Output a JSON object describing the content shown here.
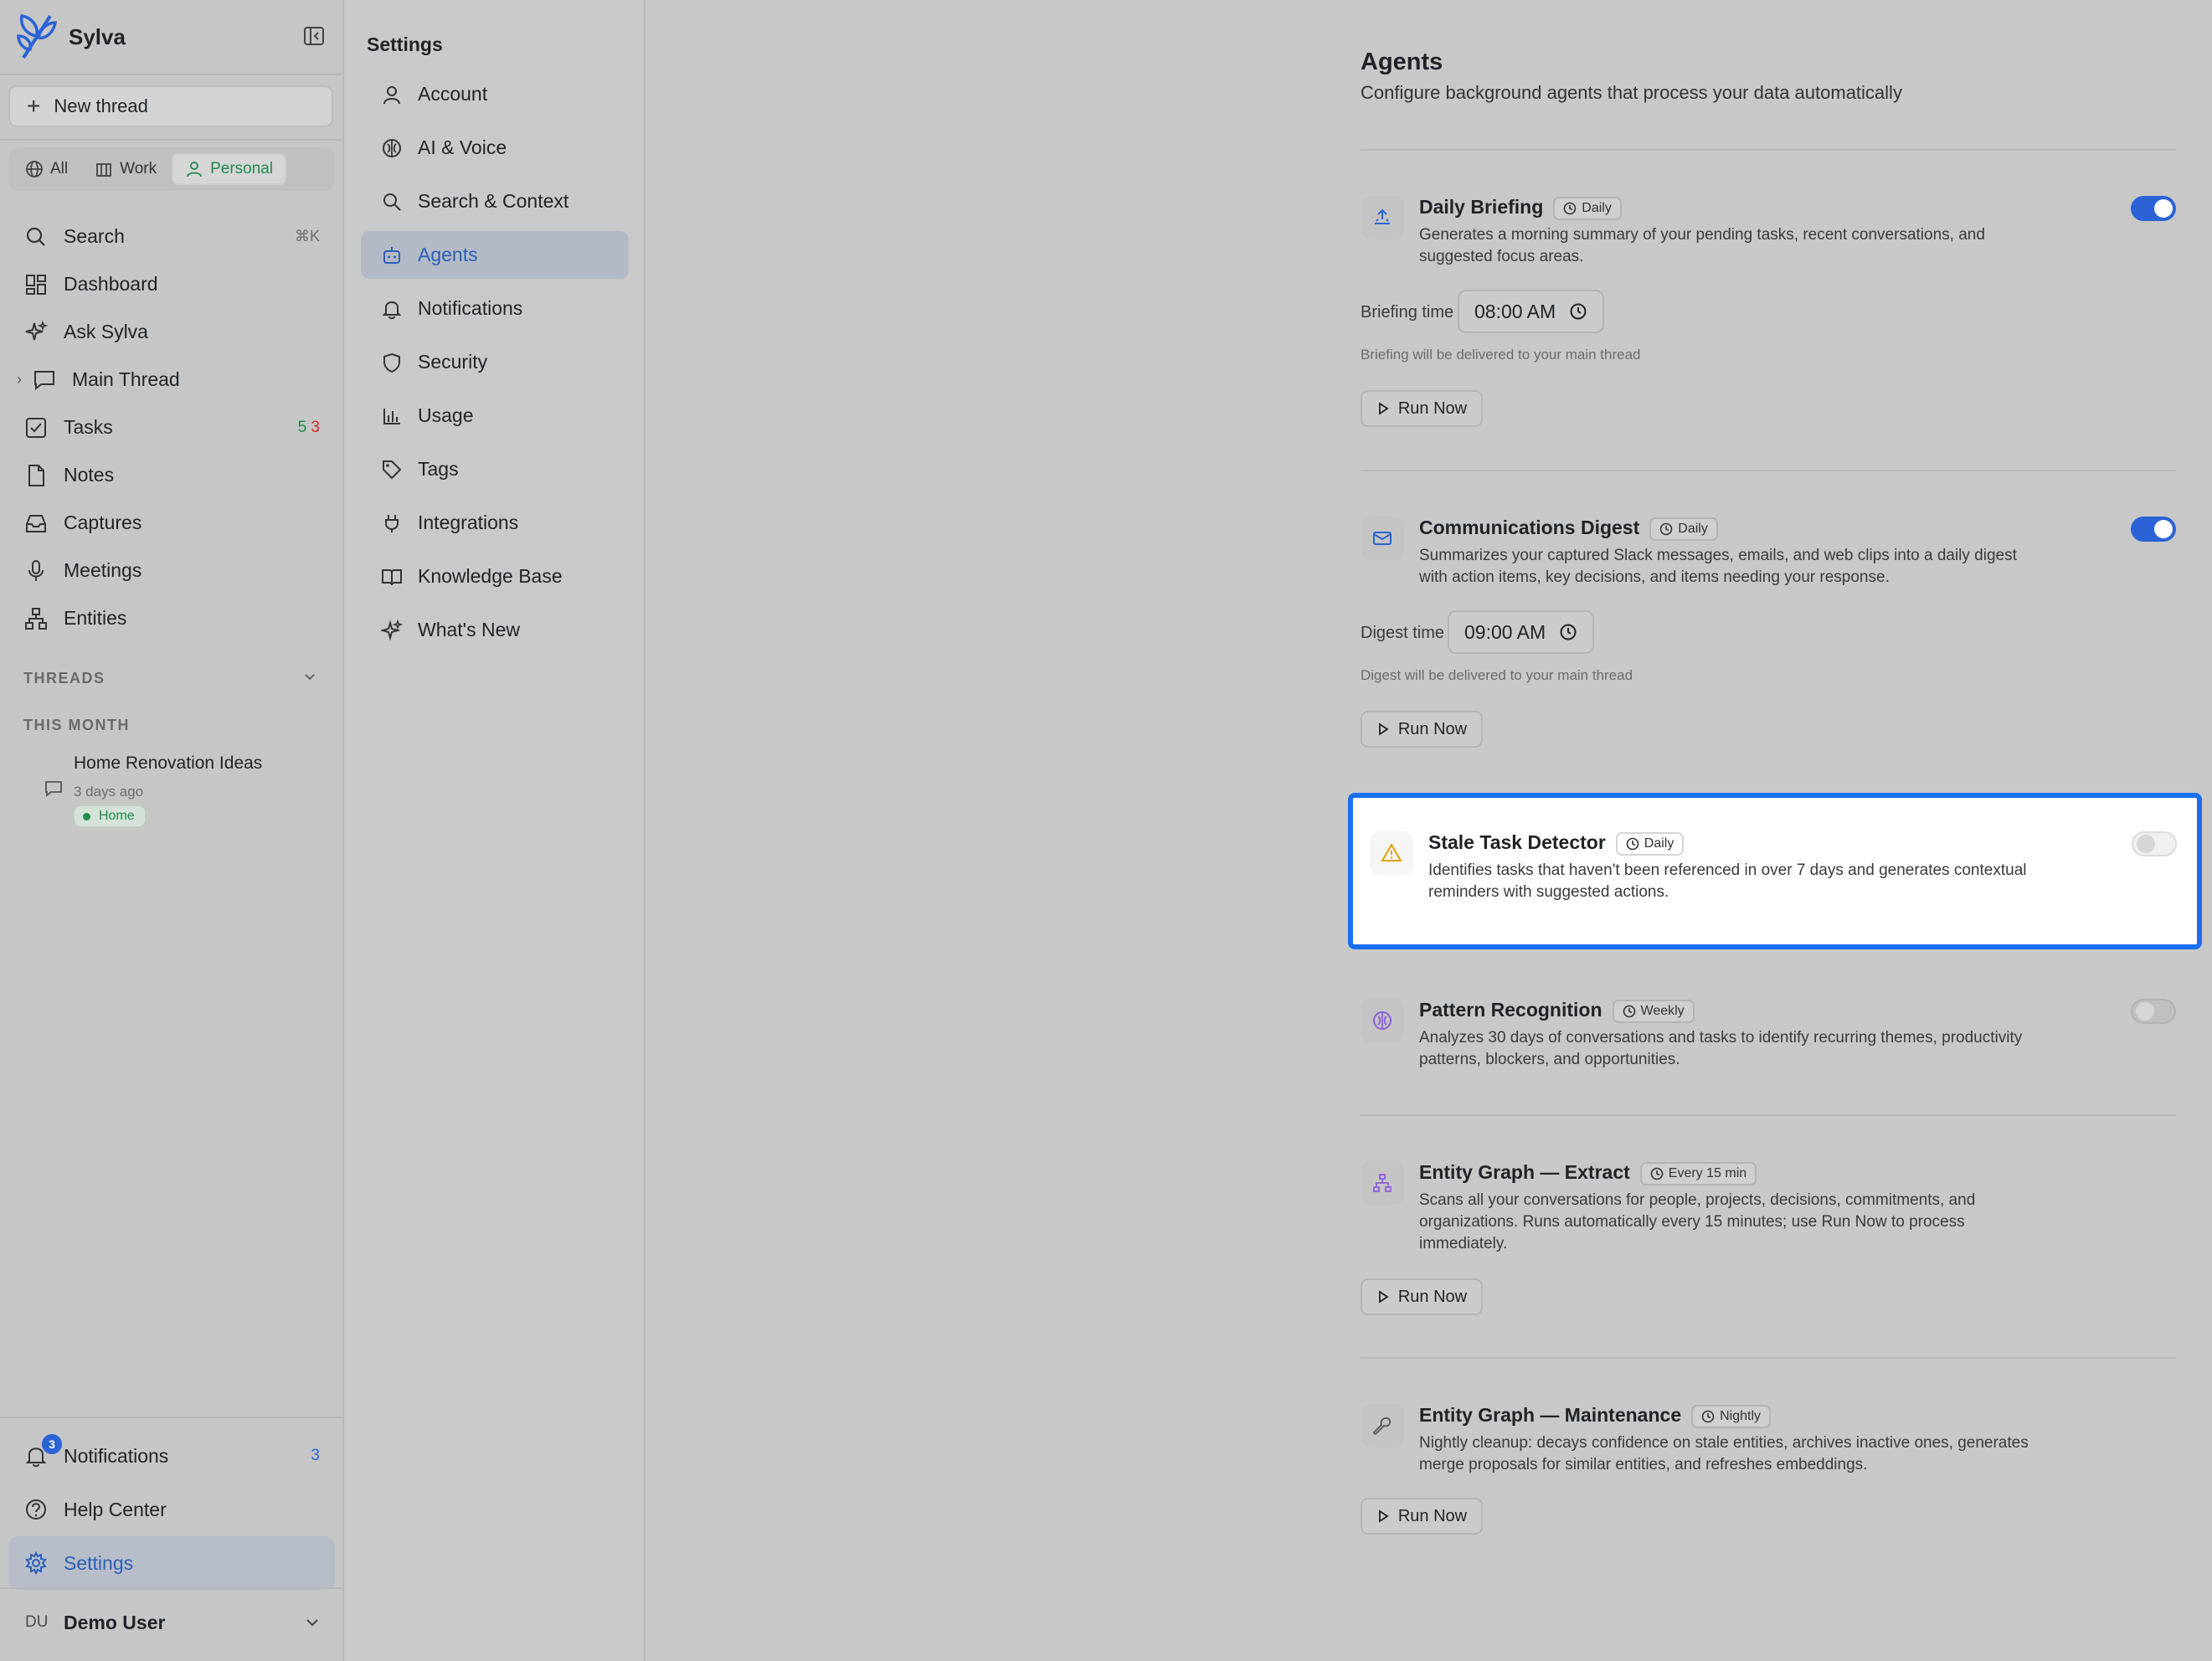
{
  "brand": {
    "name": "Sylva"
  },
  "new_thread_label": "New thread",
  "scopes": [
    {
      "label": "All"
    },
    {
      "label": "Work"
    },
    {
      "label": "Personal"
    }
  ],
  "nav": {
    "search": {
      "label": "Search",
      "shortcut": "⌘K"
    },
    "dashboard": {
      "label": "Dashboard"
    },
    "ask": {
      "label": "Ask Sylva"
    },
    "main_thread": {
      "label": "Main Thread"
    },
    "tasks": {
      "label": "Tasks",
      "count_green": "5",
      "count_red": "3"
    },
    "notes": {
      "label": "Notes"
    },
    "captures": {
      "label": "Captures"
    },
    "meetings": {
      "label": "Meetings"
    },
    "entities": {
      "label": "Entities"
    }
  },
  "threads": {
    "section_label": "THREADS",
    "group_label": "THIS MONTH",
    "items": [
      {
        "title": "Home Renovation Ideas",
        "time": "3 days ago",
        "tag": "Home"
      }
    ]
  },
  "bottom": {
    "notifications": {
      "label": "Notifications",
      "badge": "3",
      "count": "3"
    },
    "help": {
      "label": "Help Center"
    },
    "settings": {
      "label": "Settings"
    }
  },
  "user": {
    "initials": "DU",
    "name": "Demo User"
  },
  "settings": {
    "title": "Settings",
    "items": [
      {
        "label": "Account"
      },
      {
        "label": "AI & Voice"
      },
      {
        "label": "Search & Context"
      },
      {
        "label": "Agents"
      },
      {
        "label": "Notifications"
      },
      {
        "label": "Security"
      },
      {
        "label": "Usage"
      },
      {
        "label": "Tags"
      },
      {
        "label": "Integrations"
      },
      {
        "label": "Knowledge Base"
      },
      {
        "label": "What's New"
      }
    ]
  },
  "page": {
    "title": "Agents",
    "subtitle": "Configure background agents that process your data automatically"
  },
  "agents": [
    {
      "name": "Daily Briefing",
      "schedule": "Daily",
      "description": "Generates a morning summary of your pending tasks, recent conversations, and suggested focus areas.",
      "enabled": true,
      "field_label": "Briefing time",
      "time": "08:00 AM",
      "hint": "Briefing will be delivered to your main thread",
      "run_label": "Run Now"
    },
    {
      "name": "Communications Digest",
      "schedule": "Daily",
      "description": "Summarizes your captured Slack messages, emails, and web clips into a daily digest with action items, key decisions, and items needing your response.",
      "enabled": true,
      "field_label": "Digest time",
      "time": "09:00 AM",
      "hint": "Digest will be delivered to your main thread",
      "run_label": "Run Now"
    },
    {
      "name": "Stale Task Detector",
      "schedule": "Daily",
      "description": "Identifies tasks that haven't been referenced in over 7 days and generates contextual reminders with suggested actions.",
      "enabled": false
    },
    {
      "name": "Pattern Recognition",
      "schedule": "Weekly",
      "description": "Analyzes 30 days of conversations and tasks to identify recurring themes, productivity patterns, blockers, and opportunities.",
      "enabled": false
    },
    {
      "name": "Entity Graph — Extract",
      "schedule": "Every 15 min",
      "description": "Scans all your conversations for people, projects, decisions, commitments, and organizations. Runs automatically every 15 minutes; use Run Now to process immediately.",
      "run_label": "Run Now"
    },
    {
      "name": "Entity Graph — Maintenance",
      "schedule": "Nightly",
      "description": "Nightly cleanup: decays confidence on stale entities, archives inactive ones, generates merge proposals for similar entities, and refreshes embeddings.",
      "run_label": "Run Now"
    }
  ],
  "colors": {
    "accent": "#2b63d6",
    "highlight_border": "#1a6ff0",
    "personal_green": "#1f8a4c",
    "task_red": "#d12b2b"
  }
}
